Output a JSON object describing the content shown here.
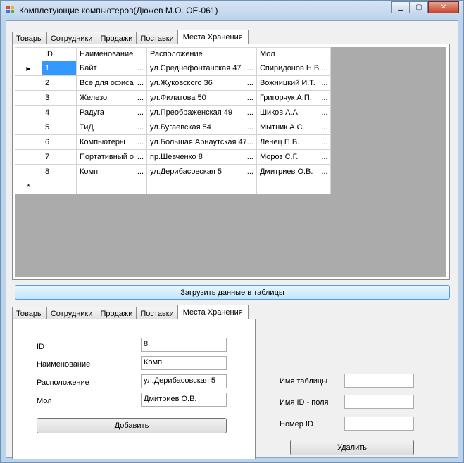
{
  "window": {
    "title": "Комплетующие компьютеров(Дюжев М.О. ОЕ-061)"
  },
  "top_tabs": [
    "Товары",
    "Сотрудники",
    "Продажи",
    "Поставки",
    "Места Хранения"
  ],
  "grid": {
    "columns": [
      "ID",
      "Наименование",
      "Расположение",
      "Мол"
    ],
    "rows": [
      [
        "1",
        "Байт",
        "ул.Среднефонтанская 47",
        "Спиридонов Н.В."
      ],
      [
        "2",
        "Все для офиса",
        "ул.Жуковского 36",
        "Вожницкий И.Т."
      ],
      [
        "3",
        "Железо",
        "ул.Филатова 50",
        "Григорчук А.П."
      ],
      [
        "4",
        "Радуга",
        "ул.Преображенская 49",
        "Шиков А.А."
      ],
      [
        "5",
        "ТиД",
        "ул.Бугаевская 54",
        "Мытник А.С."
      ],
      [
        "6",
        "Компьютеры",
        "ул.Большая Арнаутская 47",
        "Ленец П.В."
      ],
      [
        "7",
        "Портативный о",
        "пр.Шевченко 8",
        "Мороз С.Г."
      ],
      [
        "8",
        "Комп",
        "ул.Дерибасовская 5",
        "Дмитриев О.В."
      ]
    ],
    "ellipsis": "...",
    "new_row_marker": "*",
    "current_row_marker": "▶"
  },
  "load_button": "Загрузить данные в таблицы",
  "bottom_tabs": [
    "Товары",
    "Сотрудники",
    "Продажи",
    "Поставки",
    "Места Хранения"
  ],
  "form": {
    "id_label": "ID",
    "id_value": "8",
    "name_label": "Наименование",
    "name_value": "Комп",
    "location_label": "Расположение",
    "location_value": "ул.Дерибасовская 5",
    "mol_label": "Мол",
    "mol_value": "Дмитриев О.В.",
    "add_button": "Добавить"
  },
  "delete_panel": {
    "table_name_label": "Имя таблицы",
    "table_name_value": "",
    "id_field_label": "Имя ID - поля",
    "id_field_value": "",
    "id_number_label": "Номер ID",
    "id_number_value": "",
    "delete_button": "Удалить"
  },
  "colors": {
    "selection": "#3399ff",
    "grid_background": "#ababab",
    "titlebar": "#bcd3ec"
  }
}
